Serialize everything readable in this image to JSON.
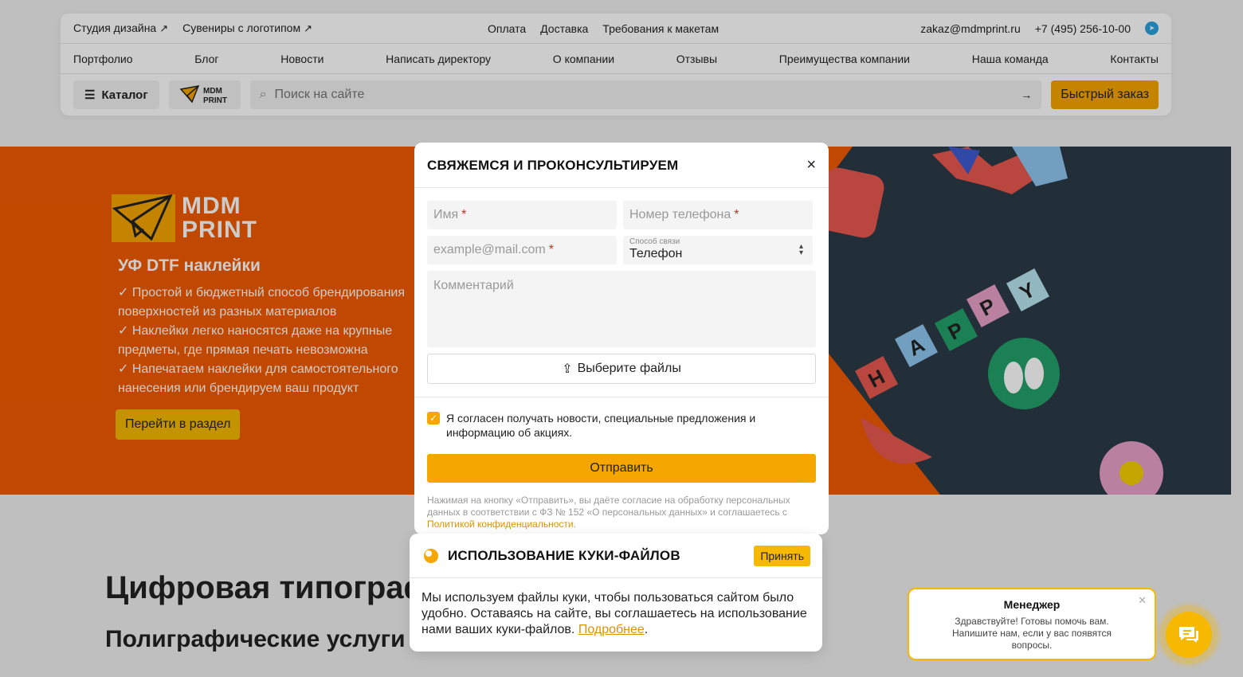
{
  "topbar": {
    "left_links": [
      {
        "label": "Студия дизайна",
        "arrow": "↗"
      },
      {
        "label": "Сувениры с логотипом",
        "arrow": "↗"
      }
    ],
    "mid_links": [
      "Оплата",
      "Доставка",
      "Требования к макетам"
    ],
    "email": "zakaz@mdmprint.ru",
    "phone": "+7 (495) 256-10-00"
  },
  "nav": [
    "Портфолио",
    "Блог",
    "Новости",
    "Написать директору",
    "О компании",
    "Отзывы",
    "Преимущества компании",
    "Наша команда",
    "Контакты"
  ],
  "toolbar": {
    "catalog_label": "Каталог",
    "logo_line1": "MDM",
    "logo_line2": "PRINT",
    "search_placeholder": "Поиск на сайте",
    "quick_order_label": "Быстрый заказ"
  },
  "banner": {
    "logo_line1": "MDM",
    "logo_line2": "PRINT",
    "title": "УФ DTF наклейки",
    "points": [
      "✓ Простой и бюджетный способ брендирования поверхностей из разных материалов",
      "✓ Наклейки легко наносятся даже на крупные предметы, где прямая печать невозможна",
      "✓ Напечатаем наклейки для самостоятельного нанесения или брендируем ваш продукт"
    ],
    "button_label": "Перейти в раздел",
    "sticker_text": [
      "H",
      "A",
      "P",
      "P",
      "Y"
    ]
  },
  "page": {
    "heading1": "Цифровая типограф",
    "heading2": "Полиграфические услуги"
  },
  "modal": {
    "title": "СВЯЖЕМСЯ И ПРОКОНСУЛЬТИРУЕМ",
    "name_placeholder": "Имя",
    "phone_placeholder": "Номер телефона",
    "email_placeholder": "example@mail.com",
    "required_mark": "*",
    "contact_caption": "Способ связи",
    "contact_value": "Телефон",
    "comment_placeholder": "Комментарий",
    "files_label": "Выберите файлы",
    "agree_text": "Я согласен получать новости, специальные предложения и информацию об акциях.",
    "agree_checked": true,
    "submit_label": "Отправить",
    "legal_text": "Нажимая на кнопку «Отправить», вы даёте согласие на обработку персональных данных в соответствии с ФЗ № 152 «О персональных данных» и соглашаетесь с ",
    "legal_link": "Политикой конфиденциальности",
    "legal_end": "."
  },
  "cookie": {
    "title": "ИСПОЛЬЗОВАНИЕ КУКИ-ФАЙЛОВ",
    "accept_label": "Принять",
    "text": "Мы используем файлы куки, чтобы пользоваться сайтом было удобно. Оставаясь на сайте, вы соглашаетесь на использование нами ваших куки-файлов. ",
    "more_label": "Подробнее",
    "text_end": "."
  },
  "manager": {
    "name": "Менеджер",
    "text": "Здравствуйте! Готовы помочь вам. Напишите нам, если у вас появятся вопросы."
  },
  "colors": {
    "accent": "#f6a600",
    "banner_bg": "#f15b00",
    "telegram": "#2aa3df"
  }
}
